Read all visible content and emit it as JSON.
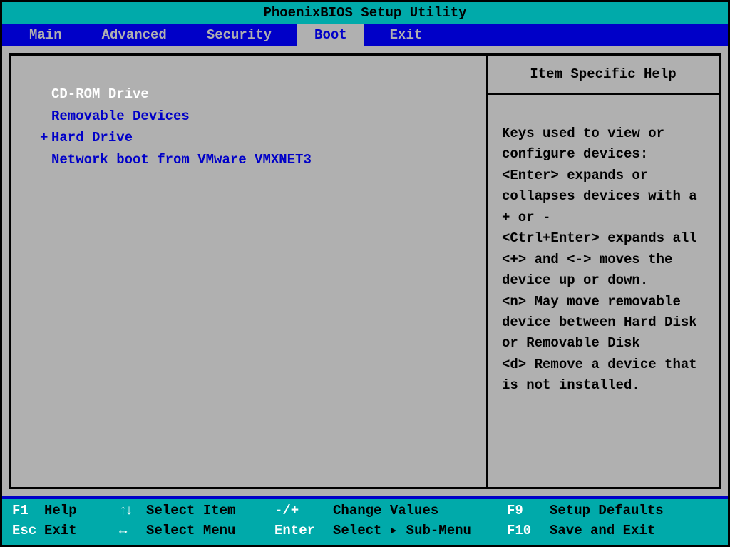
{
  "title": "PhoenixBIOS Setup Utility",
  "menu": {
    "items": [
      "Main",
      "Advanced",
      "Security",
      "Boot",
      "Exit"
    ],
    "active": "Boot"
  },
  "boot_list": [
    {
      "prefix": " ",
      "label": "CD-ROM Drive",
      "selected": true
    },
    {
      "prefix": " ",
      "label": "Removable Devices",
      "selected": false
    },
    {
      "prefix": "+",
      "label": "Hard Drive",
      "selected": false
    },
    {
      "prefix": " ",
      "label": "Network boot from VMware VMXNET3",
      "selected": false
    }
  ],
  "help": {
    "header": "Item Specific Help",
    "text": "Keys used to view or configure devices:\n<Enter> expands or collapses devices with a + or -\n<Ctrl+Enter> expands all\n<+> and <-> moves the device up or down.\n<n> May move removable device between Hard Disk or Removable Disk\n<d> Remove a device that is not installed."
  },
  "footer": {
    "f1_key": "F1",
    "f1_label": "Help",
    "esc_key": "Esc",
    "esc_label": "Exit",
    "updown_label": "Select Item",
    "leftright_label": "Select Menu",
    "plusminus_key": "-/+",
    "plusminus_label": "Change Values",
    "enter_key": "Enter",
    "enter_label_pre": "Select ",
    "enter_label_post": " Sub-Menu",
    "f9_key": "F9",
    "f9_label": "Setup Defaults",
    "f10_key": "F10",
    "f10_label": "Save and Exit"
  }
}
